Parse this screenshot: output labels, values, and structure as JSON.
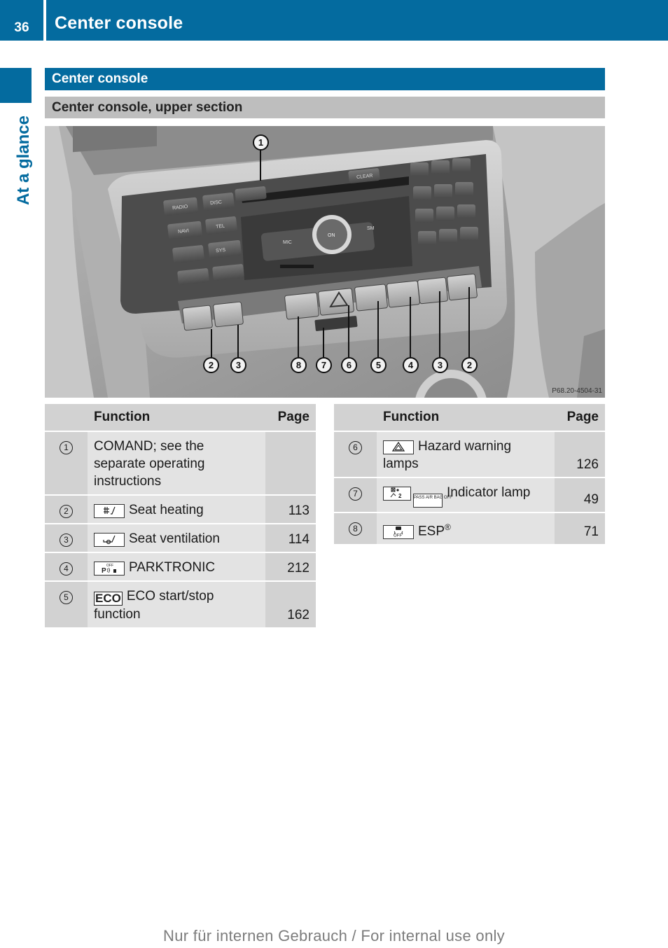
{
  "header": {
    "page_number": "36",
    "title": "Center console"
  },
  "side_tab": {
    "label": "At a glance"
  },
  "section": {
    "heading": "Center console",
    "subheading": "Center console, upper section"
  },
  "figure": {
    "code": "P68.20-4504-31",
    "callouts": [
      "1",
      "2",
      "3",
      "8",
      "7",
      "6",
      "5",
      "4",
      "3",
      "2"
    ],
    "button_labels": [
      "RADIO",
      "DISC",
      "NAVI",
      "TEL",
      "SYS",
      "CLEAR",
      "ON",
      "MIC",
      "SM"
    ]
  },
  "tables": {
    "headers": {
      "num": "",
      "function": "Function",
      "page": "Page"
    },
    "left": [
      {
        "num": "1",
        "icon": "",
        "function": "COMAND; see the separate operating instructions",
        "page": ""
      },
      {
        "num": "2",
        "icon": "seat-heating-icon",
        "function": "Seat heating",
        "page": "113"
      },
      {
        "num": "3",
        "icon": "seat-ventilation-icon",
        "function": "Seat ventilation",
        "page": "114"
      },
      {
        "num": "4",
        "icon": "parktronic-off-icon",
        "function": "PARKTRONIC",
        "page": "212"
      },
      {
        "num": "5",
        "icon": "eco-icon",
        "icon_text": "ECO",
        "function": "ECO start/stop function",
        "page": "162"
      }
    ],
    "right": [
      {
        "num": "6",
        "icon": "hazard-warning-icon",
        "function": "Hazard warning lamps",
        "page": "126"
      },
      {
        "num": "7",
        "icon": "passenger-airbag-off-icon",
        "icon_text": "PASS AIR BAG OFF",
        "function": "Indicator lamp",
        "page": "49"
      },
      {
        "num": "8",
        "icon": "esp-off-icon",
        "icon_text": "OFF",
        "function": "ESP",
        "function_sup": "®",
        "page": "71"
      }
    ]
  },
  "footer": {
    "text": "Nur für internen Gebrauch / For internal use only"
  }
}
